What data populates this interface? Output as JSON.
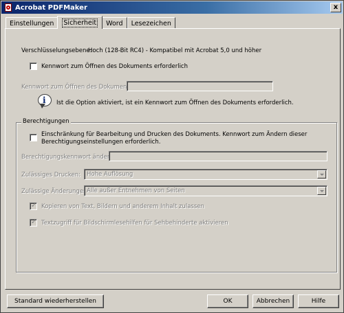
{
  "window": {
    "title": "Acrobat PDFMaker",
    "close_glyph": "x"
  },
  "tabs": [
    {
      "label": "Einstellungen",
      "active": false
    },
    {
      "label": "Sicherheit",
      "active": true
    },
    {
      "label": "Word",
      "active": false
    },
    {
      "label": "Lesezeichen",
      "active": false
    }
  ],
  "encryption": {
    "label": "Verschlüsselungsebene:",
    "value": "Hoch (128-Bit RC4) - Kompatibel mit Acrobat 5,0 und höher"
  },
  "open_password": {
    "checkbox_label": "Kennwort zum Öffnen des Dokuments erforderlich",
    "checked": false,
    "field_label": "Kennwort zum Öffnen des Dokuments:",
    "field_value": ""
  },
  "info": {
    "icon": "info-icon",
    "text": "Ist die Option aktiviert, ist ein Kennwort zum Öffnen des Dokuments erforderlich."
  },
  "permissions": {
    "group_label": "Berechtigungen",
    "restrict_label_line1": "Einschränkung für Bearbeitung und Drucken des Dokuments. Kennwort zum Ändern dieser",
    "restrict_label_line2": "Berechtigungseinstellungen erforderlich.",
    "restrict_checked": false,
    "password_label": "Berechtigungskennwort ändern:",
    "password_value": "",
    "printing_label": "Zulässiges Drucken:",
    "printing_value": "Hohe Auflösung",
    "changes_label": "Zulässige Änderungen:",
    "changes_value": "Alle außer Entnehmen von Seiten",
    "copy_label": "Kopieren von Text, Bildern und anderem Inhalt zulassen",
    "copy_checked": true,
    "access_label": "Textzugriff für Bildschirmlesehilfen für Sehbehinderte aktivieren",
    "access_checked": true
  },
  "buttons": {
    "restore": "Standard wiederherstellen",
    "ok": "OK",
    "cancel": "Abbrechen",
    "help": "Hilfe"
  }
}
